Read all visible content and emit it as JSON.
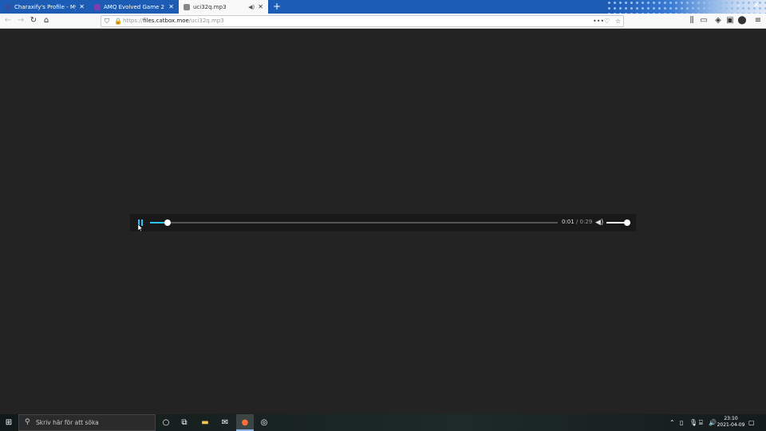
{
  "browser": {
    "tabs": [
      {
        "label": "Charaxify's Profile - MyAnimeList",
        "favicon_color": "#2e51a2",
        "active": false
      },
      {
        "label": "AMQ Evolved Game 2!",
        "favicon_color": "#7b3fb0",
        "active": false
      },
      {
        "label": "uci32q.mp3",
        "favicon_color": "#888888",
        "active": true
      }
    ],
    "url_domain": "files.catbox.moe",
    "url_path": "/uci32q.mp3",
    "url_prefix": "https://"
  },
  "player": {
    "state": "playing",
    "current_time": "0:01",
    "separator": " / ",
    "duration": "0:29",
    "progress_fraction": 0.043,
    "volume_fraction": 1.0,
    "accent_color": "#2ec2f5"
  },
  "taskbar": {
    "search_placeholder": "Skriv här för att söka",
    "time": "23:10",
    "date": "2021-04-09"
  }
}
